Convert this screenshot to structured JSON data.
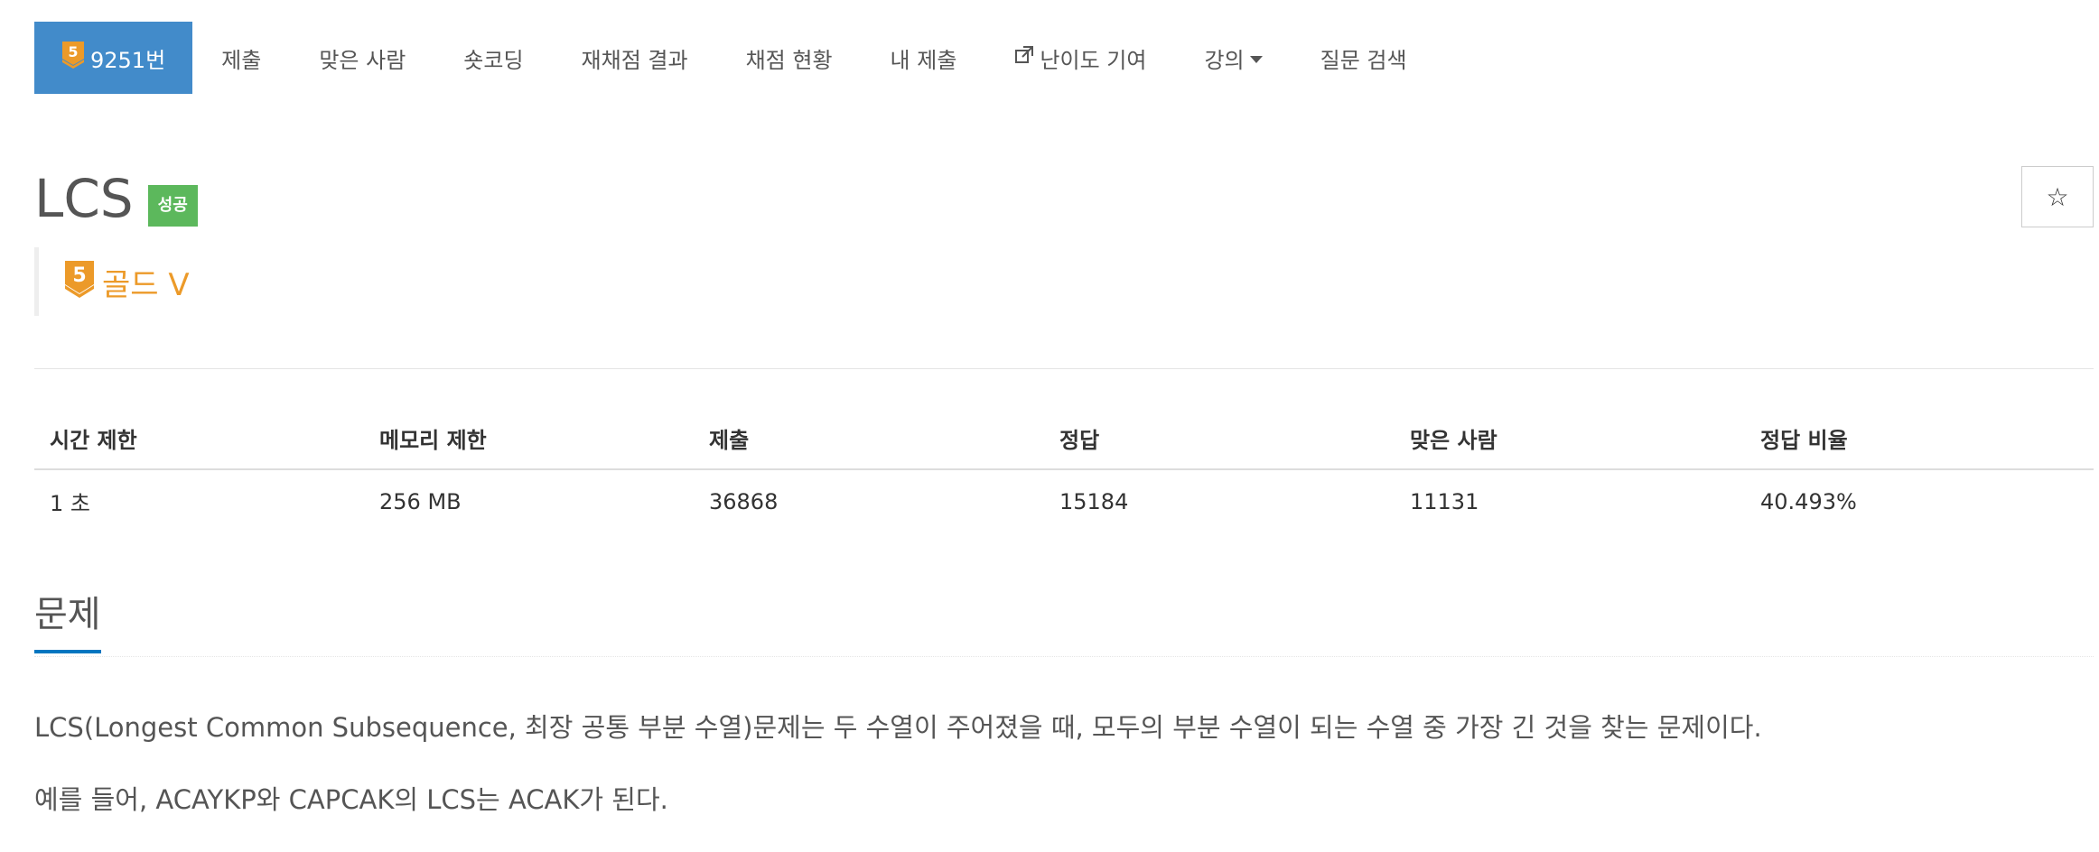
{
  "nav": {
    "problem_number": "9251번",
    "tier_number": "5",
    "items": [
      {
        "label": "제출"
      },
      {
        "label": "맞은 사람"
      },
      {
        "label": "숏코딩"
      },
      {
        "label": "재채점 결과"
      },
      {
        "label": "채점 현황"
      },
      {
        "label": "내 제출"
      },
      {
        "label": "난이도 기여"
      },
      {
        "label": "강의"
      },
      {
        "label": "질문 검색"
      }
    ]
  },
  "problem": {
    "title": "LCS",
    "status_label": "성공",
    "star_icon": "☆",
    "tier_number": "5",
    "tier_name": "골드 V"
  },
  "info_table": {
    "headers": [
      "시간 제한",
      "메모리 제한",
      "제출",
      "정답",
      "맞은 사람",
      "정답 비율"
    ],
    "values": [
      "1 초",
      "256 MB",
      "36868",
      "15184",
      "11131",
      "40.493%"
    ]
  },
  "section": {
    "heading": "문제",
    "paragraphs": [
      "LCS(Longest Common Subsequence, 최장 공통 부분 수열)문제는 두 수열이 주어졌을 때, 모두의 부분 수열이 되는 수열 중 가장 긴 것을 찾는 문제이다.",
      "예를 들어, ACAYKP와 CAPCAK의 LCS는 ACAK가 된다."
    ]
  },
  "colors": {
    "nav_active_bg": "#428bca",
    "success_label": "#5cb85c",
    "gold_tier": "#ec9a29",
    "heading_underline": "#0076c0"
  },
  "icons": {
    "tier_badge": "gold-tier-shield-icon",
    "external_link": "external-link-icon",
    "dropdown": "caret-down-icon",
    "star": "star-outline-icon"
  }
}
